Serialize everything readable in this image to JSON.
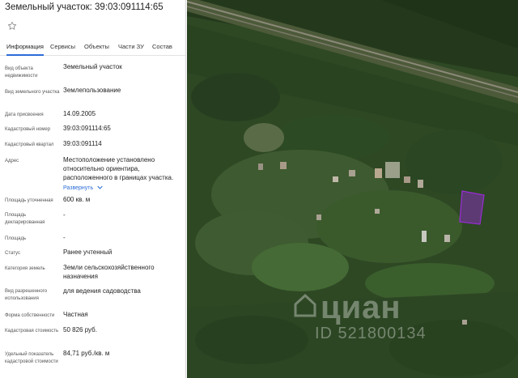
{
  "header": {
    "title": "Земельный участок: 39:03:091114:65"
  },
  "tabs": [
    {
      "label": "Информация",
      "active": true
    },
    {
      "label": "Сервисы",
      "active": false
    },
    {
      "label": "Объекты",
      "active": false
    },
    {
      "label": "Части ЗУ",
      "active": false
    },
    {
      "label": "Состав",
      "active": false
    }
  ],
  "rows": [
    {
      "label": "Вид объекта недвижимости",
      "value": "Земельный участок"
    },
    {
      "label": "Вид земельного участка",
      "value": "Землепользование"
    },
    {
      "label": "Дата присвоения",
      "value": "14.09.2005"
    },
    {
      "label": "Кадастровый номер",
      "value": "39:03:091114:65"
    },
    {
      "label": "Кадастровый квартал",
      "value": "39:03:091114"
    },
    {
      "label": "Адрес",
      "value": "Местоположение установлено относительно ориентира, расположенного в границах участка.",
      "expand": "Развернуть"
    },
    {
      "label": "Площадь уточненная",
      "value": "600 кв. м"
    },
    {
      "label": "Площадь декларированная",
      "value": "-"
    },
    {
      "label": "Площадь",
      "value": "-"
    },
    {
      "label": "Статус",
      "value": "Ранее учтенный"
    },
    {
      "label": "Категория земель",
      "value": "Земли сельскохозяйственного назначения"
    },
    {
      "label": "Вид разрешенного использования",
      "value": "для ведения садоводства"
    },
    {
      "label": "Форма собственности",
      "value": "Частная"
    },
    {
      "label": "Кадастровая стоимость",
      "value": "50 826 руб."
    },
    {
      "label": "Удельный показатель кадастровой стоимости",
      "value": "84,71 руб./кв. м"
    }
  ],
  "watermark": {
    "logo": "циан",
    "id": "ID 521800134"
  },
  "colors": {
    "accent": "#2b6cd8",
    "parcel": "#9a2bd6",
    "text": "#222222",
    "label": "#555555"
  },
  "icons": {
    "favorite": "star-outline-icon",
    "expand": "chevron-down-icon",
    "watermark": "cian-house-icon"
  }
}
